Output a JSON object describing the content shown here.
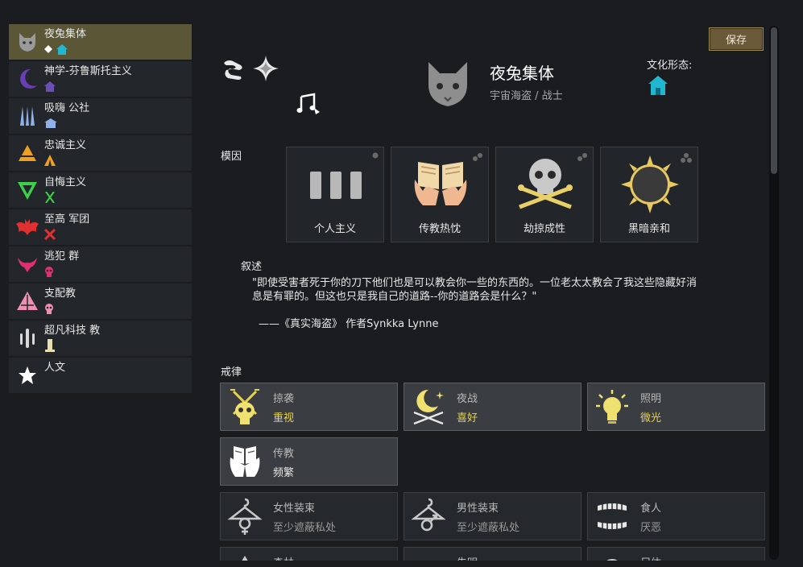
{
  "sidebar": {
    "items": [
      {
        "label": "夜兔集体"
      },
      {
        "label": "神学-芬鲁斯托主义"
      },
      {
        "label": "吸嗨 公社"
      },
      {
        "label": "忠诚主义"
      },
      {
        "label": "自悔主义"
      },
      {
        "label": "至高 军团"
      },
      {
        "label": "逃犯 群"
      },
      {
        "label": "支配教"
      },
      {
        "label": "超凡科技 教"
      },
      {
        "label": "人文"
      }
    ]
  },
  "toolbar": {
    "save_label": "保存"
  },
  "ideo": {
    "name": "夜兔集体",
    "subtitle": "宇宙海盗 / 战士",
    "culture_form_label": "文化形态:"
  },
  "memes": {
    "label": "模因",
    "items": [
      {
        "name": "个人主义"
      },
      {
        "name": "传教热忱"
      },
      {
        "name": "劫掠成性"
      },
      {
        "name": "黑暗亲和"
      }
    ]
  },
  "narrative": {
    "label": "叙述",
    "quote_line1": "\"即使受害者死于你的刀下他们也是可以教会你一些的东西的。一位老太太教会了我这些隐藏好消",
    "quote_line2": "息是有罪的。但这也只是我自己的道路--你的道路会是什么？\"",
    "author": "——《真实海盗》 作者Synkka Lynne"
  },
  "precepts": {
    "label": "戒律",
    "items": [
      {
        "name": "掠袭",
        "value": "重视"
      },
      {
        "name": "夜战",
        "value": "喜好"
      },
      {
        "name": "照明",
        "value": "微光"
      },
      {
        "name": "传教",
        "value": "频繁"
      },
      {
        "name": "女性装束",
        "value": "至少遮蔽私处"
      },
      {
        "name": "男性装束",
        "value": "至少遮蔽私处"
      },
      {
        "name": "食人",
        "value": "厌恶"
      },
      {
        "name": "森林"
      },
      {
        "name": "失明"
      },
      {
        "name": "尸体"
      }
    ]
  },
  "colors": {
    "accent_yellow": "#e8d44a",
    "selected_bg": "#5a5636",
    "culture_teal": "#1fb8d0"
  }
}
